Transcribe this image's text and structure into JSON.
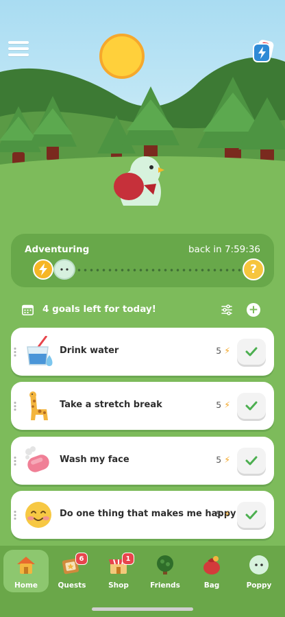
{
  "adventure": {
    "title": "Adventuring",
    "return_time": "back in 7:59:36",
    "end_marker": "?"
  },
  "goals": {
    "header": "4 goals left for today!",
    "add_symbol": "+",
    "items": [
      {
        "title": "Drink water",
        "points": "5",
        "icon": "water-glass-icon"
      },
      {
        "title": "Take a stretch break",
        "points": "5",
        "icon": "giraffe-icon"
      },
      {
        "title": "Wash my face",
        "points": "5",
        "icon": "soap-icon"
      },
      {
        "title": "Do one thing that makes me happy",
        "points": "5",
        "icon": "smiling-face-icon"
      }
    ]
  },
  "tabs": [
    {
      "label": "Home",
      "icon": "house-icon",
      "active": true
    },
    {
      "label": "Quests",
      "icon": "quest-board-icon",
      "badge": "6"
    },
    {
      "label": "Shop",
      "icon": "shop-stall-icon",
      "badge": "1"
    },
    {
      "label": "Friends",
      "icon": "tree-icon"
    },
    {
      "label": "Bag",
      "icon": "bag-icon"
    },
    {
      "label": "Poppy",
      "icon": "poppy-face-icon"
    }
  ],
  "colors": {
    "grass": "#7dbb5b",
    "card_dark": "#68a84a",
    "check_green": "#4caf50",
    "energy": "#f3a21b"
  }
}
